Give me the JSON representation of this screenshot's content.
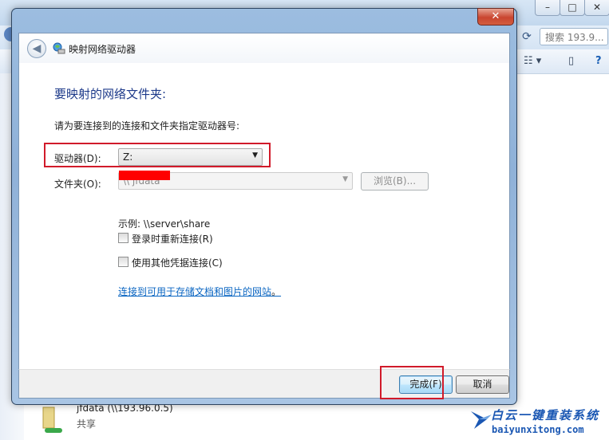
{
  "background_window": {
    "caption_buttons": [
      "–",
      "□",
      "✕"
    ],
    "search_placeholder": "搜索 193.9...",
    "item": {
      "title": "jfdata (\\\\193.96.0.5)",
      "subtitle": "共享"
    }
  },
  "watermark": {
    "title": "白云一键重装系统",
    "url": "baiyunxitong.com"
  },
  "dialog": {
    "title": "映射网络驱动器",
    "close_label": "✕",
    "heading": "要映射的网络文件夹:",
    "instruction": "请为要连接到的连接和文件夹指定驱动器号:",
    "drive": {
      "label": "驱动器(D):",
      "value": "Z:"
    },
    "folder": {
      "label": "文件夹(O):",
      "value": "\\\\            jfdata",
      "browse_label": "浏览(B)..."
    },
    "example": "示例: \\\\server\\share",
    "reconnect_label": "登录时重新连接(R)",
    "reconnect_checked": false,
    "credentials_label": "使用其他凭据连接(C)",
    "credentials_checked": false,
    "link_text": "连接到可用于存储文档和图片的网站",
    "link_suffix": "。",
    "finish_label": "完成(F)",
    "cancel_label": "取消"
  },
  "colors": {
    "heading": "#1d3a8a",
    "link": "#0b66c2",
    "highlight": "#d11a2a",
    "redaction": "#ff0000"
  }
}
